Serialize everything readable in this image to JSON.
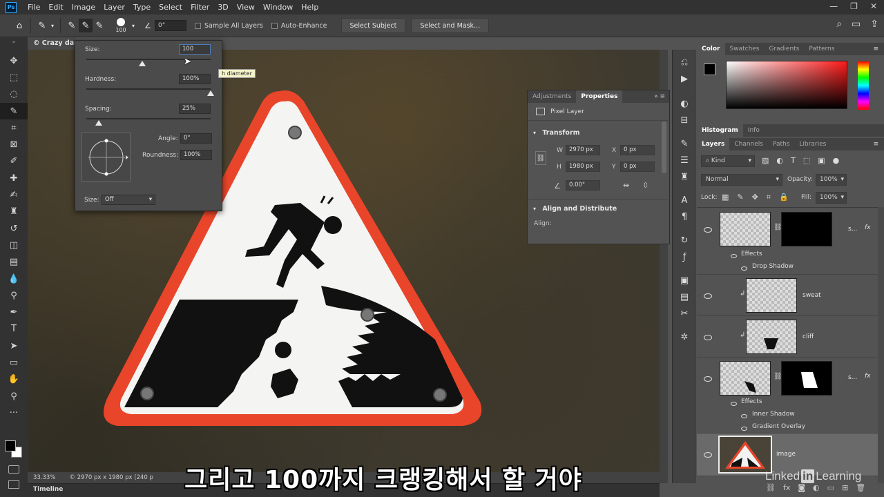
{
  "app": {
    "logo": "Ps",
    "menu": [
      "File",
      "Edit",
      "Image",
      "Layer",
      "Type",
      "Select",
      "Filter",
      "3D",
      "View",
      "Window",
      "Help"
    ],
    "window_controls": [
      "—",
      "❐",
      "✕"
    ]
  },
  "options_bar": {
    "brush_size": "100",
    "angle_value": "0°",
    "sample_all_layers": "Sample All Layers",
    "auto_enhance": "Auto-Enhance",
    "select_subject": "Select Subject",
    "select_and_mask": "Select and Mask..."
  },
  "document": {
    "tab_title": "© Crazy dar",
    "zoom": "33.33%",
    "doc_info": "© 2970 px x 1980 px (240 p",
    "timeline_label": "Timeline"
  },
  "brush_popup": {
    "size_label": "Size:",
    "size_value": "100",
    "hardness_label": "Hardness:",
    "hardness_value": "100%",
    "spacing_label": "Spacing:",
    "spacing_value": "25%",
    "angle_label": "Angle:",
    "angle_value": "0°",
    "roundness_label": "Roundness:",
    "roundness_value": "100%",
    "size_control_label": "Size:",
    "size_control_value": "Off",
    "tooltip": "h diameter",
    "size_fraction": 0.45,
    "hardness_fraction": 1.0,
    "spacing_fraction": 0.1
  },
  "properties": {
    "tabs": [
      "Adjustments",
      "Properties"
    ],
    "layer_kind": "Pixel Layer",
    "transform_label": "Transform",
    "w_label": "W",
    "w_value": "2970 px",
    "h_label": "H",
    "h_value": "1980 px",
    "x_label": "X",
    "x_value": "0 px",
    "y_label": "Y",
    "y_value": "0 px",
    "rotation_value": "0.00°",
    "align_section": "Align and Distribute",
    "align_label": "Align:"
  },
  "color_panel": {
    "tabs": [
      "Color",
      "Swatches",
      "Gradients",
      "Patterns"
    ],
    "foreground": "#000000",
    "background": "#ffffff"
  },
  "histogram_tabs": [
    "Histogram",
    "Info"
  ],
  "layers_panel": {
    "tabs": [
      "Layers",
      "Channels",
      "Paths",
      "Libraries"
    ],
    "filter_kind": "Kind",
    "blend_mode": "Normal",
    "opacity_label": "Opacity:",
    "opacity_value": "100%",
    "lock_label": "Lock:",
    "fill_label": "Fill:",
    "fill_value": "100%",
    "layers": [
      {
        "name": "s...",
        "effects_label": "Effects",
        "effects": [
          "Drop Shadow"
        ]
      },
      {
        "name": "sweat"
      },
      {
        "name": "cliff"
      },
      {
        "name": "s...",
        "effects_label": "Effects",
        "effects": [
          "Inner Shadow",
          "Gradient Overlay"
        ]
      },
      {
        "name": "image"
      }
    ]
  },
  "subtitle": "그리고 100까지 크랭킹해서 할 거야",
  "watermark": {
    "before": "Linked",
    "in": "in",
    "after": "Learning"
  }
}
